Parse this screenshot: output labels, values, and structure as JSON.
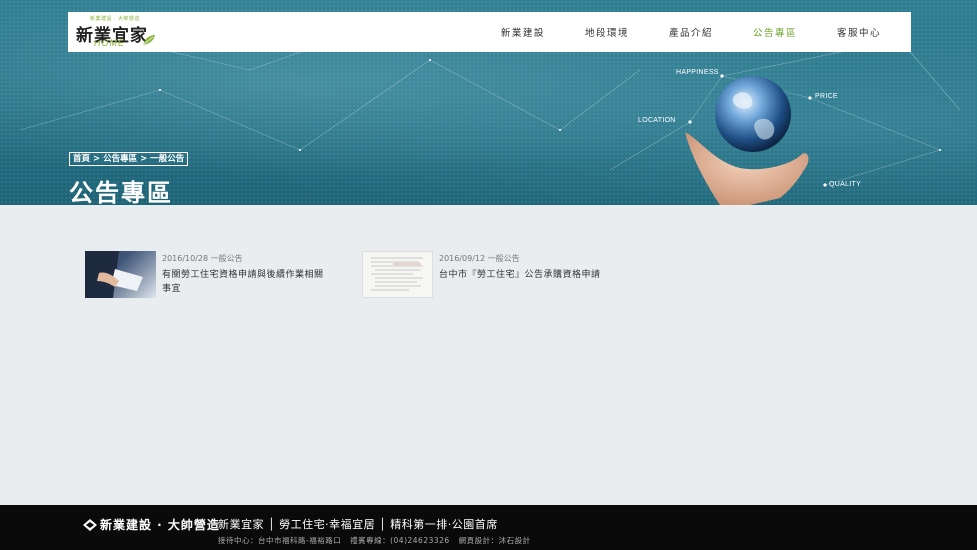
{
  "header": {
    "logo": {
      "small_text": "新業建設 · 大帥營造",
      "main_text": "新業宜家",
      "home_text": "HOME"
    },
    "nav": [
      {
        "label": "新業建設",
        "active": false
      },
      {
        "label": "地段環境",
        "active": false
      },
      {
        "label": "產品介紹",
        "active": false
      },
      {
        "label": "公告專區",
        "active": true
      },
      {
        "label": "客服中心",
        "active": false
      }
    ]
  },
  "hero": {
    "breadcrumb": {
      "home": "首頁",
      "section": "公告專區",
      "current": "一般公告",
      "separator": ">"
    },
    "title": "公告專區",
    "globe_labels": {
      "happiness": "HAPPINESS",
      "price": "PRICE",
      "location": "LOCATION",
      "quality": "QUALITY"
    }
  },
  "news": [
    {
      "date": "2016/10/28",
      "category": "一般公告",
      "title": "有關勞工住宅資格申請與後續作業相關事宜"
    },
    {
      "date": "2016/09/12",
      "category": "一般公告",
      "title": "台中市『勞工住宅』公告承購資格申請"
    }
  ],
  "footer": {
    "brand": "新業建設 · 大帥營造",
    "tagline": "新業宜家 │ 勞工住宅·幸福宜居 │ 精科第一排·公園首席",
    "info": {
      "reception": "接待中心：台中市福科路-福裕路口",
      "hotline": "禮賓專線：(04)24623326",
      "design": "網頁設計：沐石設計"
    }
  },
  "colors": {
    "accent_green": "#6ea42e",
    "hero_teal": "#2a7689",
    "footer_bg": "#0a0a0a",
    "page_bg": "#e9edf0"
  }
}
